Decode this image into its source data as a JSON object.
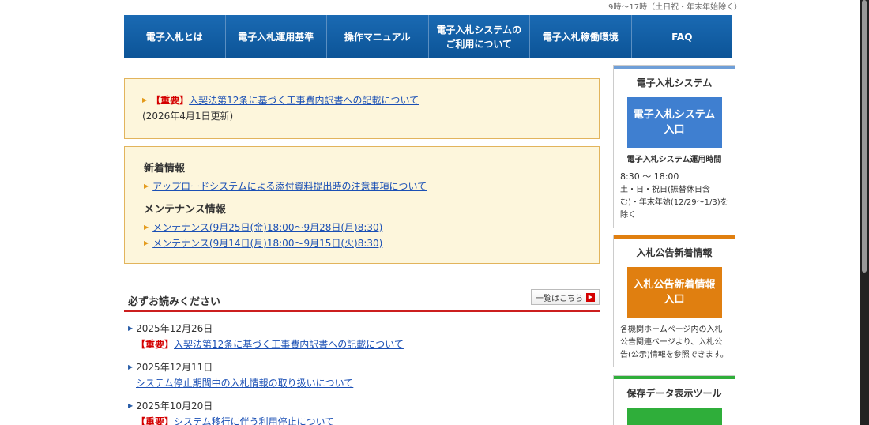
{
  "header": {
    "hours_note": "9時～17時（土日祝・年末年始除く）"
  },
  "nav": [
    "電子入札とは",
    "電子入札運用基準",
    "操作マニュアル",
    "電子入札システムの\nご利用について",
    "電子入札稼働環境",
    "FAQ"
  ],
  "notice": {
    "tag": "【重要】",
    "link": "入契法第12条に基づく工事費内訳書への記載について",
    "updated": "(2026年4月1日更新)"
  },
  "whatsnew": {
    "title": "新着情報",
    "items": [
      "アップロードシステムによる添付資料提出時の注意事項について"
    ],
    "maint_title": "メンテナンス情報",
    "maint_items": [
      "メンテナンス(9月25日(金)18:00～9月28日(月)8:30)",
      "メンテナンス(9月14日(月)18:00～9月15日(火)8:30)"
    ]
  },
  "must_read": {
    "title": "必ずお読みください",
    "list_button": "一覧はこちら",
    "items": [
      {
        "date": "2025年12月26日",
        "tag": "【重要】",
        "link": "入契法第12条に基づく工事費内訳書への記載について"
      },
      {
        "date": "2025年12月11日",
        "tag": "",
        "link": "システム停止期間中の入札情報の取り扱いについて"
      },
      {
        "date": "2025年10月20日",
        "tag": "【重要】",
        "link": "システム移行に伴う利用停止について"
      }
    ]
  },
  "side": {
    "ebid": {
      "title": "電子入札システム",
      "button": "電子入札システム\n入口",
      "hours_title": "電子入札システム運用時間",
      "hours_1": "8:30 ～ 18:00",
      "hours_2": "土・日・祝日(振替休日含む)・年末年始(12/29～1/3)を除く"
    },
    "notice": {
      "title": "入札公告新着情報",
      "button": "入札公告新着情報\n入口",
      "desc": "各機関ホームページ内の入札公告関連ページより、入札公告(公示)情報を参照できます。"
    },
    "tool": {
      "title": "保存データ表示ツール"
    }
  },
  "colors": {
    "nav": "#0f5da3",
    "blue_btn": "#3f7fd0",
    "orange_btn": "#e07f10",
    "green_btn": "#2fae3a"
  }
}
